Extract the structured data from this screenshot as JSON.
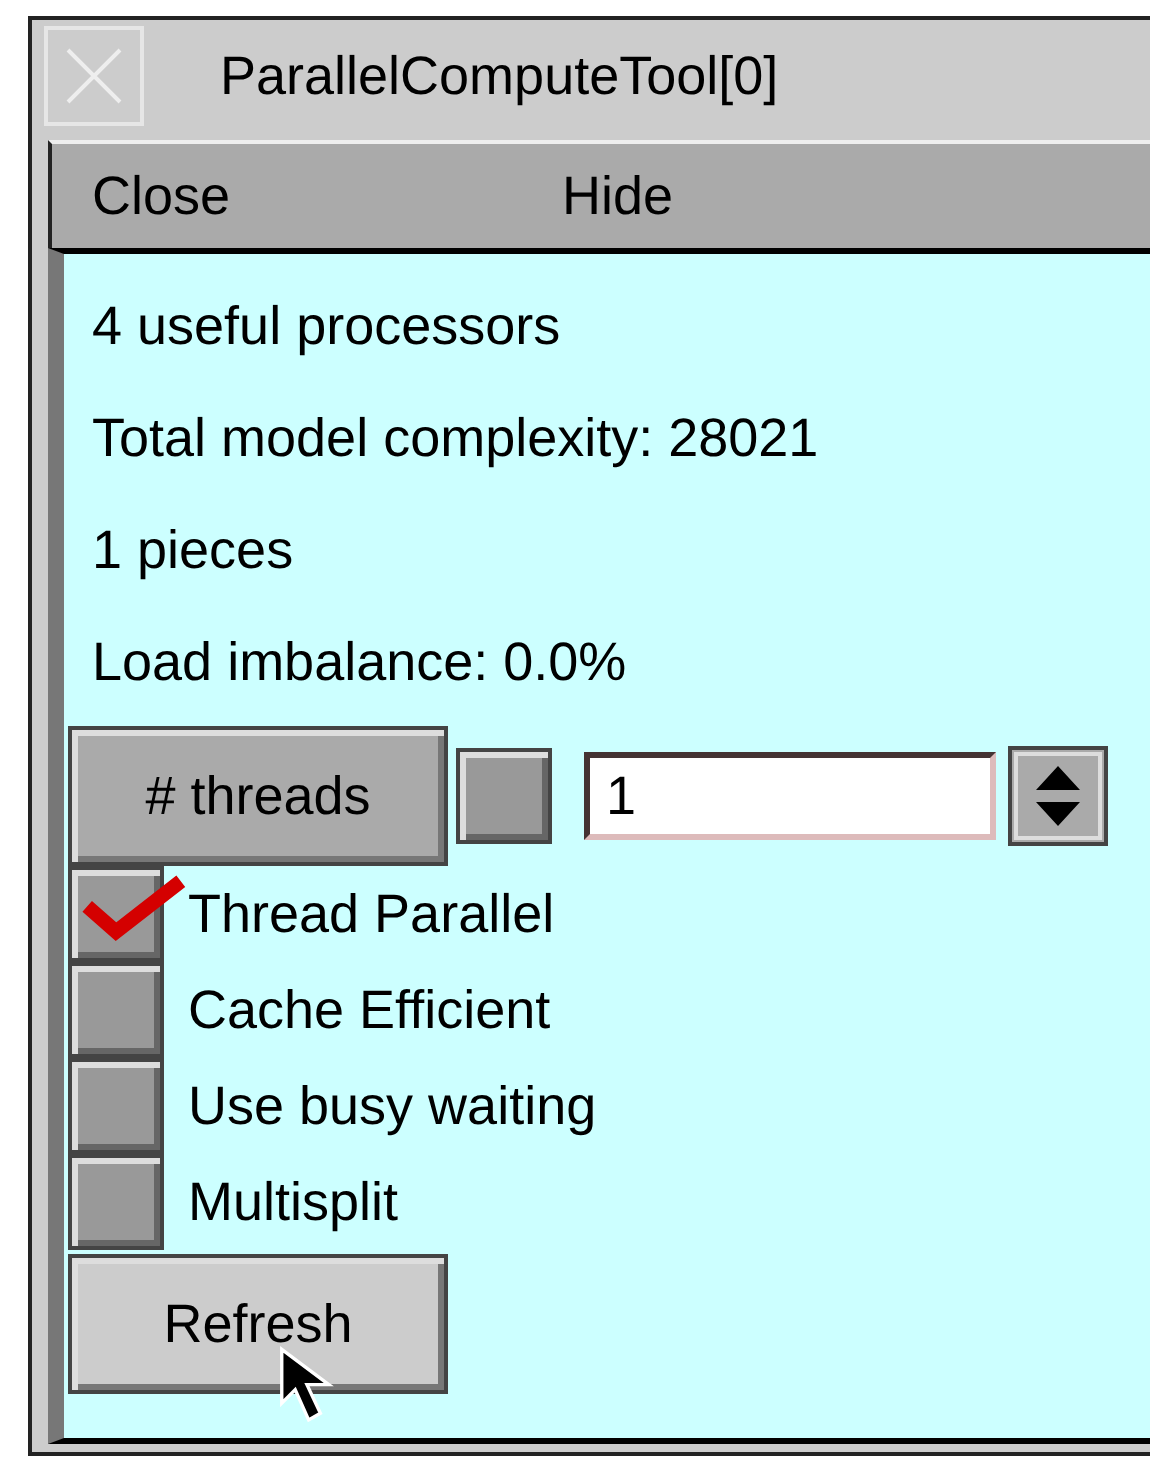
{
  "window": {
    "title": "ParallelComputeTool[0]"
  },
  "menu": [
    "Close",
    "Hide"
  ],
  "info_lines": [
    "4 useful processors",
    "Total model complexity: 28021",
    "1 pieces",
    "Load imbalance: 0.0%"
  ],
  "threads": {
    "button": "# threads",
    "toggle_checked": false,
    "value": "1"
  },
  "options": [
    {
      "label": "Thread Parallel",
      "checked": true
    },
    {
      "label": "Cache Efficient",
      "checked": false
    },
    {
      "label": "Use busy waiting",
      "checked": false
    },
    {
      "label": "Multisplit",
      "checked": false
    }
  ],
  "refresh_button": "Refresh"
}
